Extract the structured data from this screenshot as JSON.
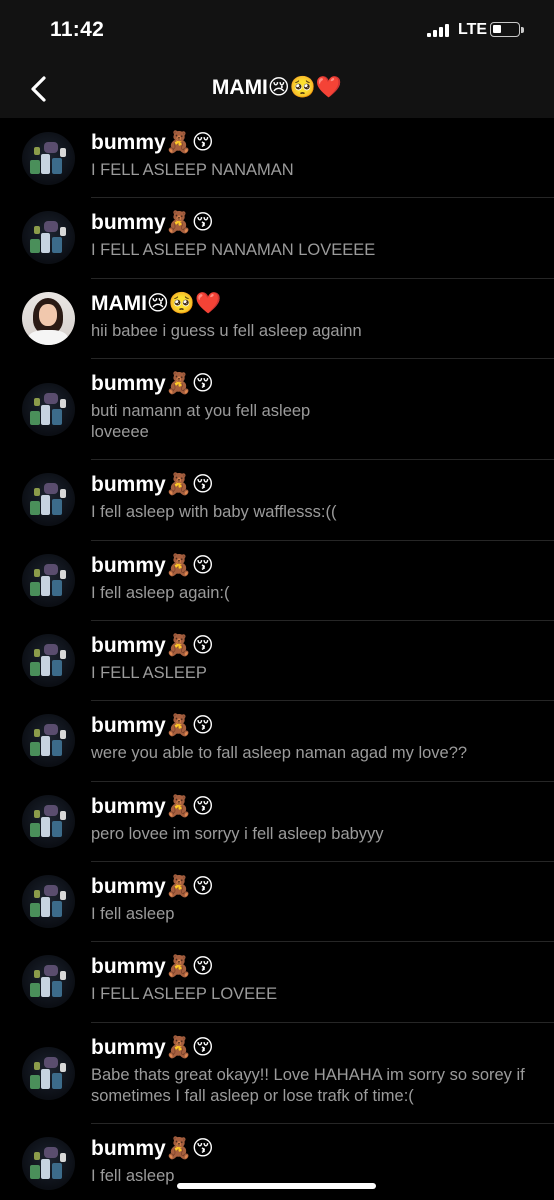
{
  "status_bar": {
    "time": "11:42",
    "network": "LTE"
  },
  "header": {
    "title": "MAMI😢🥺❤️",
    "back_icon": "chevron-left-icon"
  },
  "conversation": {
    "colors": {
      "background": "#000000",
      "bar": "#121212",
      "preview_text": "#9b9b9b",
      "divider": "#262626"
    },
    "items": [
      {
        "sender": "bummy🧸😚",
        "text": "I FELL ASLEEP NANAMAN",
        "avatar": "bear"
      },
      {
        "sender": "bummy🧸😚",
        "text": "I FELL ASLEEP NANAMAN LOVEEEE",
        "avatar": "bear"
      },
      {
        "sender": "MAMI😢🥺❤️",
        "text": "hii babee i guess u fell asleep againn",
        "avatar": "girl"
      },
      {
        "sender": "bummy🧸😚",
        "text": "buti namann at you fell asleep\nloveeee",
        "avatar": "bear"
      },
      {
        "sender": "bummy🧸😚",
        "text": "I fell asleep with baby wafflesss:((",
        "avatar": "bear"
      },
      {
        "sender": "bummy🧸😚",
        "text": "I fell asleep again:(",
        "avatar": "bear"
      },
      {
        "sender": "bummy🧸😚",
        "text": "I FELL ASLEEP",
        "avatar": "bear"
      },
      {
        "sender": "bummy🧸😚",
        "text": "were you able to fall asleep naman agad my love??",
        "avatar": "bear"
      },
      {
        "sender": "bummy🧸😚",
        "text": "pero lovee im sorryy i fell asleep babyyy",
        "avatar": "bear"
      },
      {
        "sender": "bummy🧸😚",
        "text": "I fell asleep",
        "avatar": "bear"
      },
      {
        "sender": "bummy🧸😚",
        "text": "I FELL ASLEEP LOVEEE",
        "avatar": "bear"
      },
      {
        "sender": "bummy🧸😚",
        "text": "Babe thats great okayy!! Love HAHAHA im sorry so sorey if sometimes I fall asleep or lose trafk of time:(",
        "avatar": "bear"
      },
      {
        "sender": "bummy🧸😚",
        "text": "I fell asleep",
        "avatar": "bear"
      }
    ]
  }
}
